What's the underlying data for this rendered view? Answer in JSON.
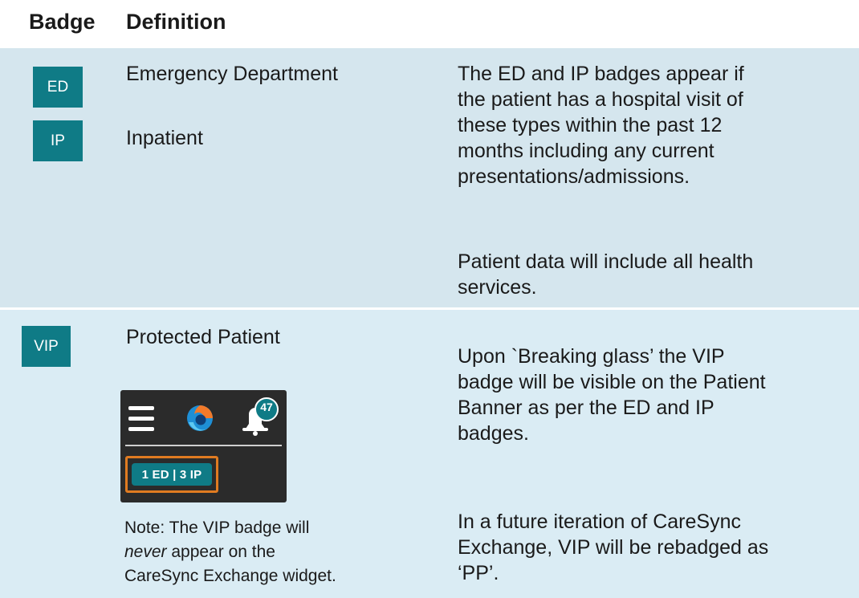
{
  "header": {
    "col_badge": "Badge",
    "col_definition": "Definition"
  },
  "rows": [
    {
      "badges": [
        {
          "code": "ED",
          "definition": "Emergency Department"
        },
        {
          "code": "IP",
          "definition": "Inpatient"
        }
      ],
      "description_lines": [
        "The ED and IP badges appear if",
        "the patient has a hospital visit of",
        "these types within the past 12",
        "months including any current",
        "presentations/admissions."
      ],
      "description2_lines": [
        "Patient data will include all health",
        "services."
      ]
    },
    {
      "badges": [
        {
          "code": "VIP",
          "definition": "Protected Patient"
        }
      ],
      "widget": {
        "notification_count": "47",
        "summary": "1 ED | 3 IP"
      },
      "note": {
        "line1": "Note: The VIP badge will",
        "line2_em": "never",
        "line2_rest": " appear on the",
        "line3": "CareSync Exchange widget."
      },
      "description_lines": [
        "Upon `Breaking glass’ the VIP",
        "badge will be visible on the Patient",
        "Banner as per the ED and IP",
        "badges."
      ],
      "description2_lines": [
        "In a future iteration of CareSync",
        "Exchange, VIP will be rebadged as",
        "‘PP’."
      ]
    }
  ],
  "colors": {
    "teal": "#0f7b86",
    "row_bg": "#d5e6ee",
    "highlight": "#e07b21",
    "widget_bg": "#2b2b2b"
  }
}
